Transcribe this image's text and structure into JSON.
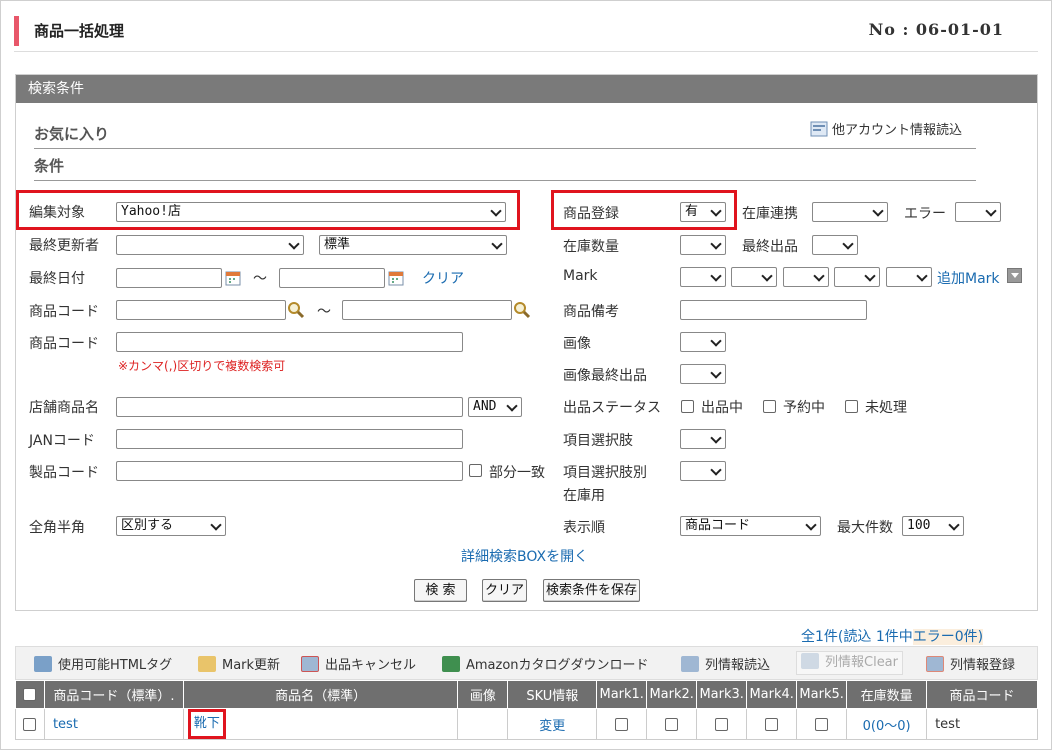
{
  "page": {
    "title": "商品一括処理",
    "number": "No : 06-01-01"
  },
  "panel": {
    "header": "検索条件",
    "favorites": "お気に入り",
    "conditions": "条件",
    "other_account": "他アカウント情報読込"
  },
  "form": {
    "edit_target_label": "編集対象",
    "edit_target_value": "Yahoo!店",
    "last_updater_label": "最終更新者",
    "last_updater_value": "",
    "standard_value": "標準",
    "last_date_label": "最終日付",
    "tilde": "～",
    "clear_link": "クリア",
    "product_code_label": "商品コード",
    "product_code2_label": "商品コード",
    "csv_note": "※カンマ(,)区切りで複数検索可",
    "store_name_label": "店舗商品名",
    "and_value": "AND",
    "jan_label": "JANコード",
    "maker_code_label": "製品コード",
    "partial_match": "部分一致",
    "width_label": "全角半角",
    "width_value": "区別する",
    "reg_label": "商品登録",
    "reg_value": "有",
    "stock_link_label": "在庫連携",
    "error_label": "エラー",
    "stock_qty_label": "在庫数量",
    "last_listing_label": "最終出品",
    "mark_label": "Mark",
    "add_mark": "追加Mark",
    "remark_label": "商品備考",
    "image_label": "画像",
    "image_last_label": "画像最終出品",
    "listing_status_label": "出品ステータス",
    "status_opts": [
      "出品中",
      "予約中",
      "未処理"
    ],
    "item_select_label": "項目選択肢",
    "item_select_stock_label": "項目選択肢別",
    "item_select_stock_label2": "在庫用",
    "order_label": "表示順",
    "order_value": "商品コード",
    "max_label": "最大件数",
    "max_value": "100",
    "detail_link": "詳細検索BOXを開く",
    "buttons": {
      "search": "検 索",
      "clear": "クリア",
      "save": "検索条件を保存"
    }
  },
  "results": {
    "summary": "全1件(読込 1件中",
    "errors": "エラー0件)"
  },
  "toolbar": [
    "使用可能HTMLタグ",
    "Mark更新",
    "出品キャンセル",
    "Amazonカタログダウンロード",
    "列情報読込",
    "列情報Clear",
    "列情報登録"
  ],
  "table": {
    "headers": [
      "商品コード（標準）.",
      "商品名（標準）",
      "画像",
      "SKU情報",
      "Mark1.",
      "Mark2.",
      "Mark3.",
      "Mark4.",
      "Mark5.",
      "在庫数量",
      "商品コード"
    ],
    "row": {
      "code": "test",
      "name": "靴下",
      "sku": "変更",
      "stock": "0(0～0)",
      "code2": "test"
    }
  },
  "colors": {
    "accent": "#e8576a",
    "highlight": "#e0141e",
    "link": "#1a6bb0",
    "header_bg": "#7a7a7a"
  }
}
